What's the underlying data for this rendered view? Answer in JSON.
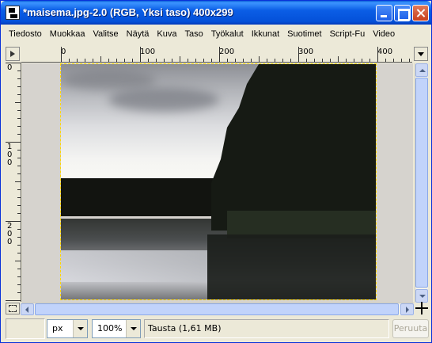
{
  "window": {
    "title": "*maisema.jpg-2.0 (RGB, Yksi taso) 400x299"
  },
  "menu": {
    "items": [
      {
        "label": "Tiedosto"
      },
      {
        "label": "Muokkaa"
      },
      {
        "label": "Valitse"
      },
      {
        "label": "Näytä"
      },
      {
        "label": "Kuva"
      },
      {
        "label": "Taso"
      },
      {
        "label": "Työkalut"
      },
      {
        "label": "Ikkunat"
      },
      {
        "label": "Suotimet"
      },
      {
        "label": "Script-Fu"
      },
      {
        "label": "Video"
      }
    ]
  },
  "rulers": {
    "horizontal_labels": [
      "0",
      "100",
      "200",
      "300",
      "400"
    ],
    "vertical_labels": [
      {
        "digits": [
          "0"
        ]
      },
      {
        "digits": [
          "1",
          "0",
          "0"
        ]
      },
      {
        "digits": [
          "2",
          "0",
          "0"
        ]
      }
    ]
  },
  "statusbar": {
    "unit": "px",
    "zoom": "100%",
    "message": "Tausta (1,61 MB)",
    "cancel_label": "Peruuta"
  }
}
